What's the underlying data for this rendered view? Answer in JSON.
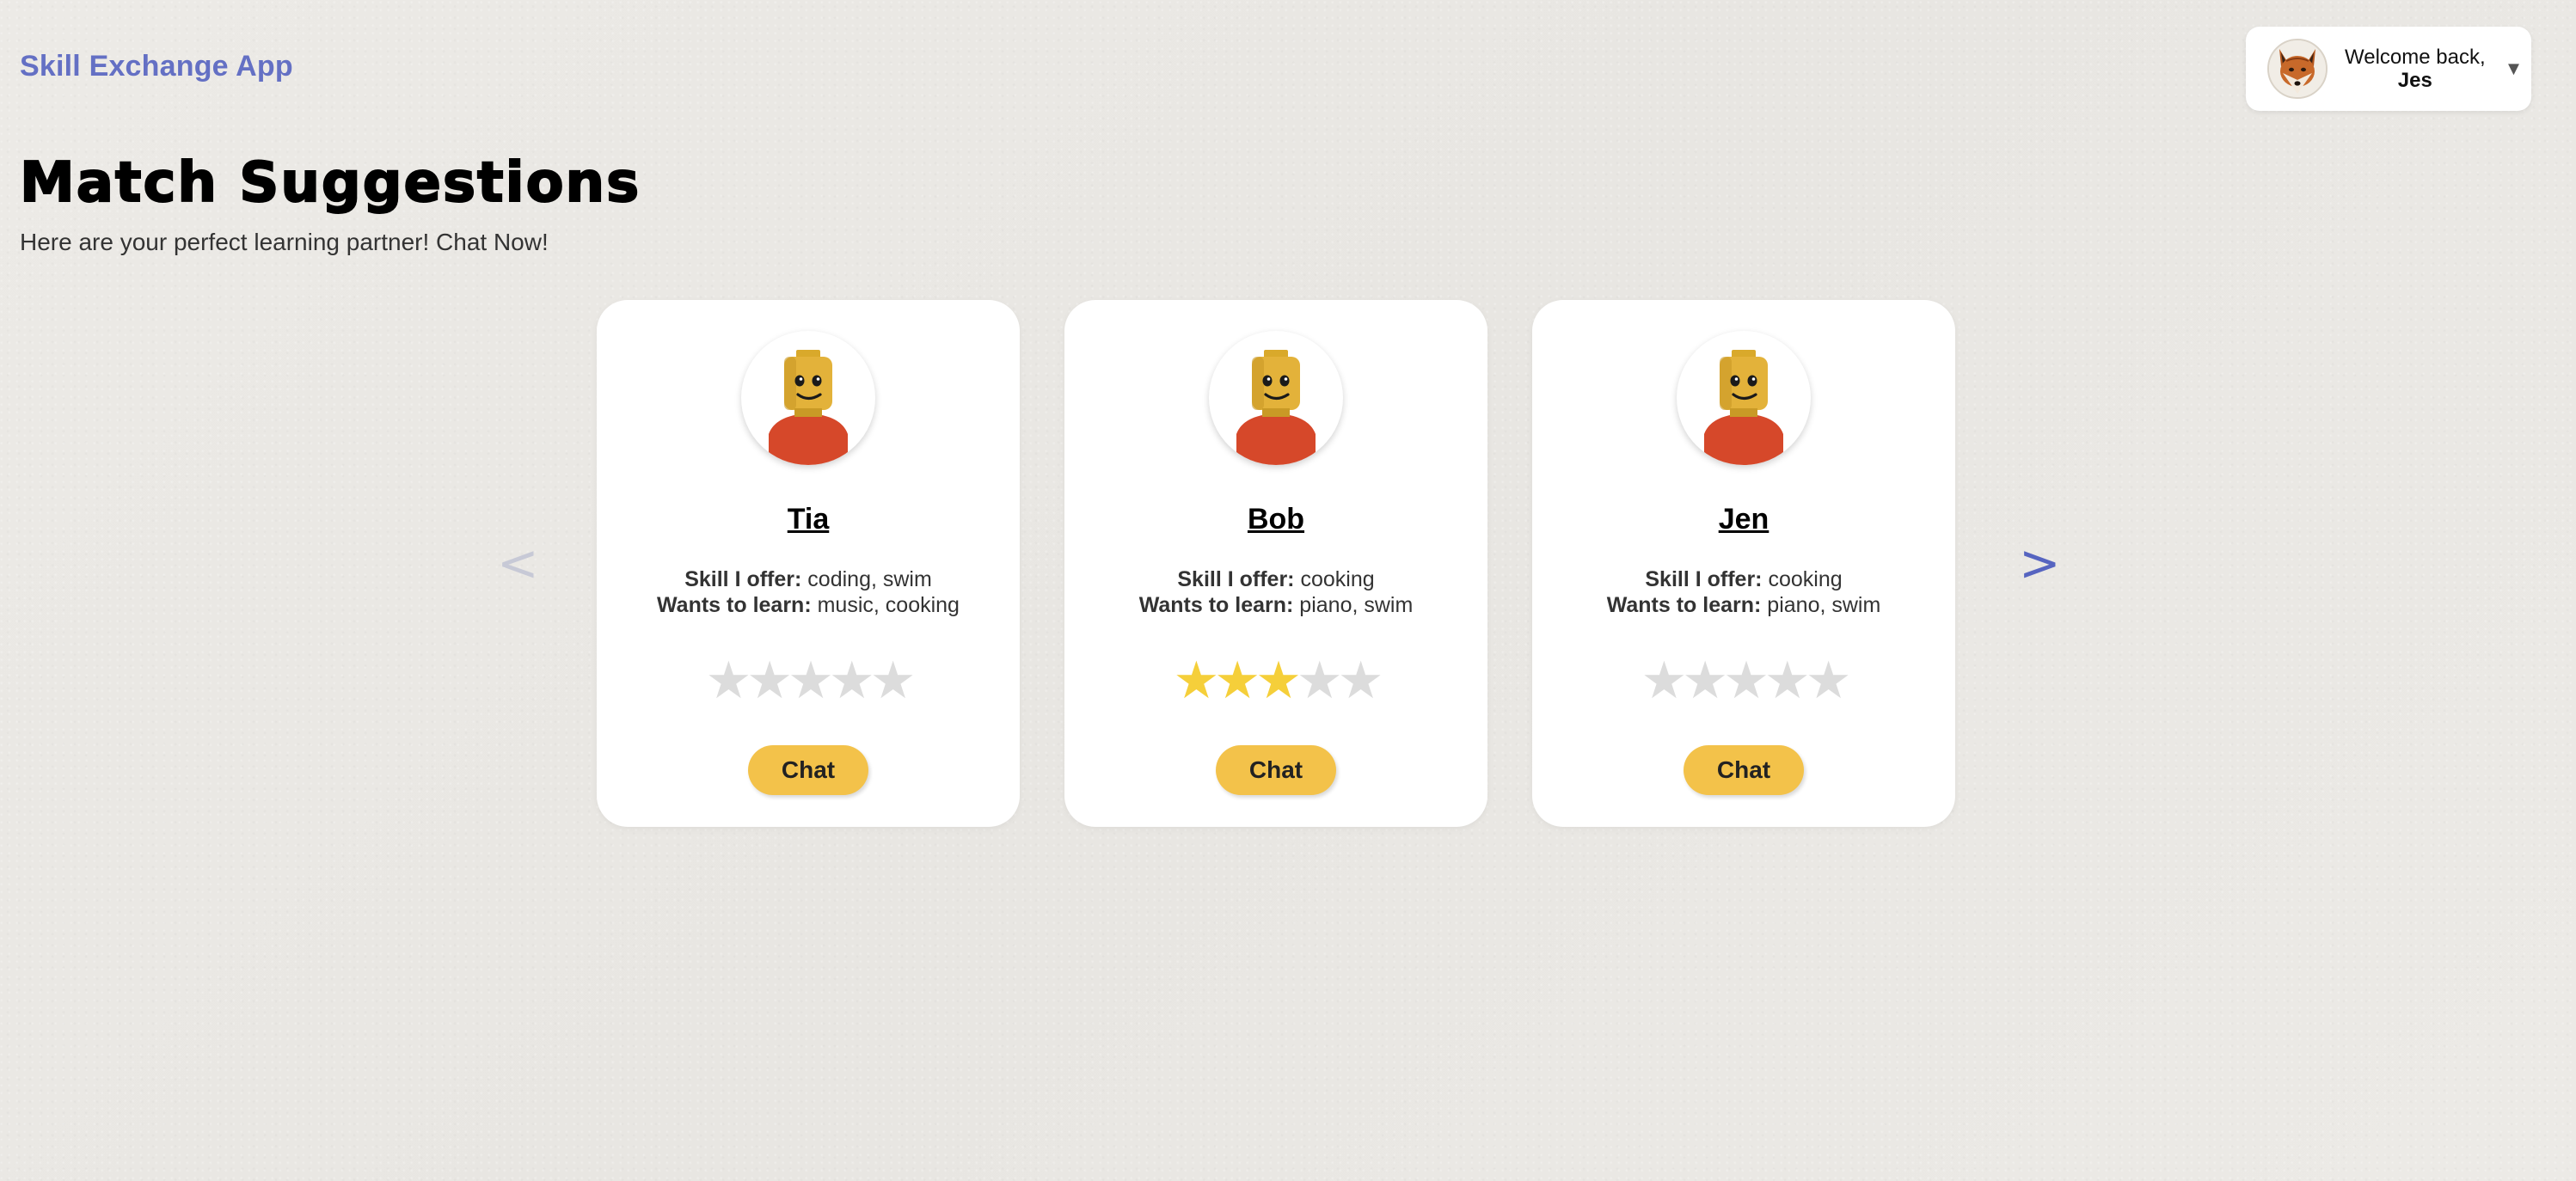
{
  "header": {
    "app_name": "Skill Exchange App",
    "welcome_text": "Welcome back,",
    "user_name": "Jes",
    "caret": "▼",
    "avatar_icon": "fox-avatar-icon"
  },
  "page": {
    "title": "Match Suggestions",
    "subtitle": "Here are your perfect learning partner! Chat Now!"
  },
  "carousel": {
    "prev_label": "<",
    "next_label": ">"
  },
  "labels": {
    "offer": "Skill I offer:",
    "learn": "Wants to learn:"
  },
  "matches": [
    {
      "name": "Tia",
      "offer": "coding, swim",
      "learn": "music, cooking",
      "rating": 0,
      "max_rating": 5,
      "button": "Chat",
      "avatar_icon": "lego-head-avatar-icon"
    },
    {
      "name": "Bob",
      "offer": "cooking",
      "learn": "piano, swim",
      "rating": 3,
      "max_rating": 5,
      "button": "Chat",
      "avatar_icon": "lego-head-avatar-icon"
    },
    {
      "name": "Jen",
      "offer": "cooking",
      "learn": "piano, swim",
      "rating": 0,
      "max_rating": 5,
      "button": "Chat",
      "avatar_icon": "lego-head-avatar-icon"
    }
  ],
  "colors": {
    "accent": "#6470c4",
    "button": "#f3c24a",
    "star_on": "#f5cf3a",
    "star_off": "#dcdcdc"
  }
}
